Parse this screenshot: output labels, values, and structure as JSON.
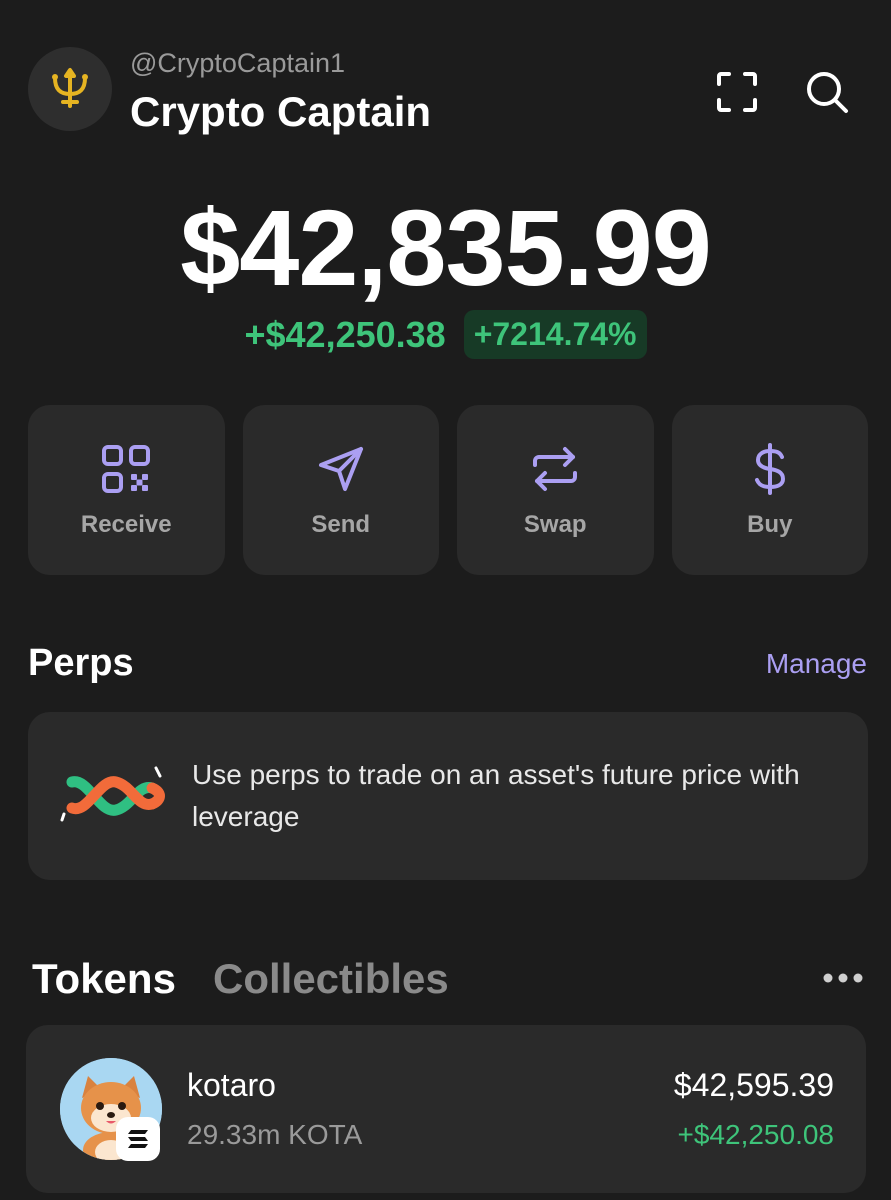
{
  "header": {
    "handle": "@CryptoCaptain1",
    "display_name": "Crypto Captain",
    "avatar_icon": "trident-icon",
    "icons": [
      "scan-icon",
      "search-icon"
    ]
  },
  "balance": {
    "total": "$42,835.99",
    "change_abs": "+$42,250.38",
    "change_pct": "+7214.74%"
  },
  "actions": [
    {
      "label": "Receive",
      "icon": "qr-code-icon"
    },
    {
      "label": "Send",
      "icon": "send-icon"
    },
    {
      "label": "Swap",
      "icon": "swap-icon"
    },
    {
      "label": "Buy",
      "icon": "dollar-icon"
    }
  ],
  "perps": {
    "title": "Perps",
    "manage_label": "Manage",
    "description": "Use perps to trade on an asset's future price with leverage",
    "icon": "infinity-logo-icon"
  },
  "tabs": {
    "tokens": "Tokens",
    "collectibles": "Collectibles",
    "more_icon": "more-icon"
  },
  "tokens": [
    {
      "name": "kotaro",
      "amount": "29.33m KOTA",
      "value": "$42,595.39",
      "change": "+$42,250.08",
      "chain_icon": "solana-icon"
    }
  ],
  "colors": {
    "background": "#1c1c1c",
    "card": "#2a2a2a",
    "accent": "#ab9ff2",
    "positive": "#3ec47a"
  }
}
